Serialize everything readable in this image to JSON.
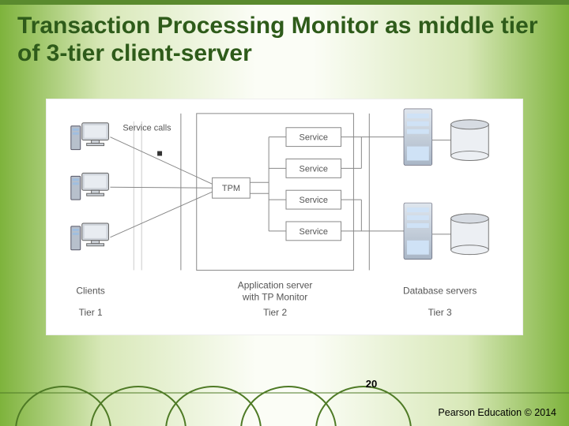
{
  "title": "Transaction Processing Monitor as middle tier of 3-tier client-server",
  "diagram": {
    "service_calls": "Service calls",
    "tpm": "TPM",
    "service": "Service",
    "tier1_label": "Clients",
    "tier1_sub": "Tier 1",
    "tier2_label": "Application server\nwith TP Monitor",
    "tier2_sub": "Tier 2",
    "tier3_label": "Database servers",
    "tier3_sub": "Tier 3"
  },
  "page_number": "20",
  "footer": "Pearson Education © 2014"
}
